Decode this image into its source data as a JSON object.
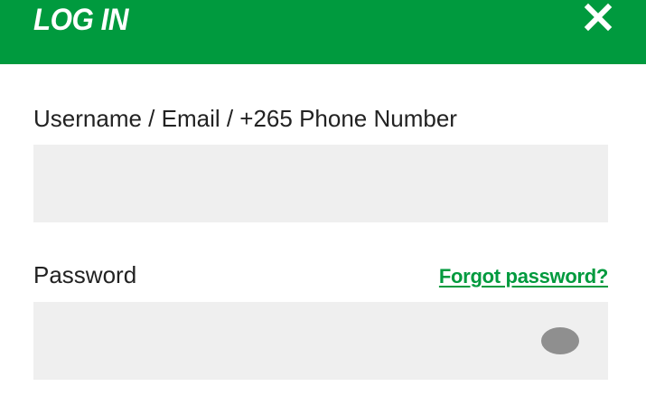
{
  "header": {
    "title": "LOG IN",
    "background_color": "#009a3e",
    "close_icon": "close-icon"
  },
  "username": {
    "label": "Username / Email / +265 Phone Number",
    "value": "",
    "placeholder": ""
  },
  "password": {
    "label": "Password",
    "value": "",
    "placeholder": "",
    "forgot_link": "Forgot password?",
    "toggle_icon": "eye-icon"
  },
  "colors": {
    "accent": "#009a3e",
    "input_background": "#efefef",
    "text": "#222222"
  }
}
